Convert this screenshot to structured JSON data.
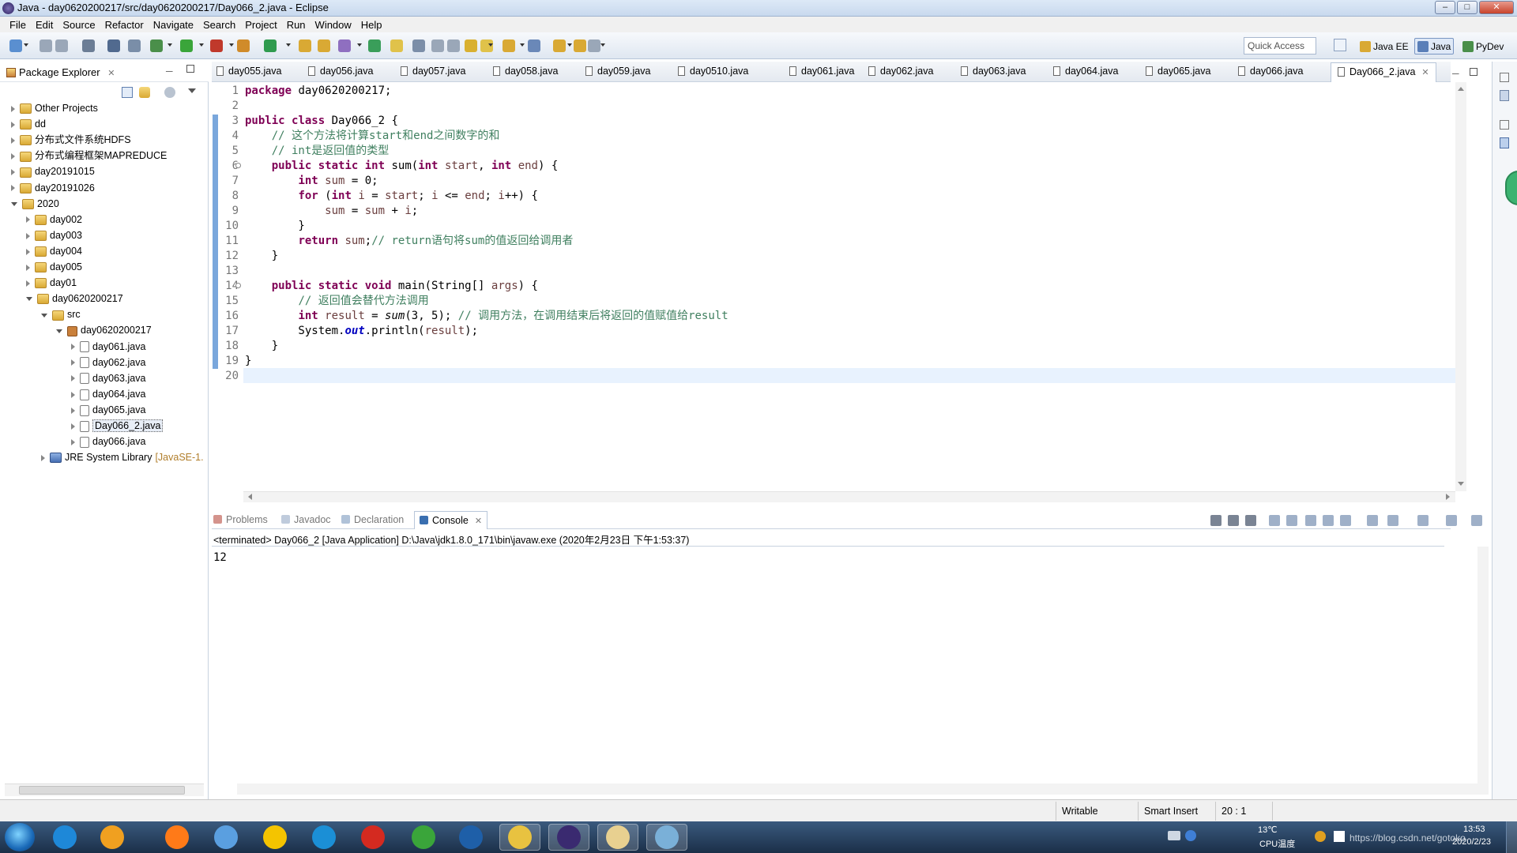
{
  "window": {
    "title": "Java - day0620200217/src/day0620200217/Day066_2.java - Eclipse"
  },
  "menu": [
    "File",
    "Edit",
    "Source",
    "Refactor",
    "Navigate",
    "Search",
    "Project",
    "Run",
    "Window",
    "Help"
  ],
  "quick_access": "Quick Access",
  "perspectives": [
    {
      "label": "Java EE",
      "selected": false
    },
    {
      "label": "Java",
      "selected": true
    },
    {
      "label": "PyDev",
      "selected": false
    }
  ],
  "package_explorer": {
    "title": "Package Explorer",
    "tree": [
      {
        "label": "Other Projects",
        "depth": 0,
        "state": "collapsed",
        "icon": "folder-icon"
      },
      {
        "label": "dd",
        "depth": 0,
        "state": "collapsed",
        "icon": "folder-icon"
      },
      {
        "label": "分布式文件系统HDFS",
        "depth": 0,
        "state": "collapsed",
        "icon": "folder-icon"
      },
      {
        "label": "分布式编程框架MAPREDUCE",
        "depth": 0,
        "state": "collapsed",
        "icon": "folder-icon"
      },
      {
        "label": "day20191015",
        "depth": 0,
        "state": "collapsed",
        "icon": "folder-icon"
      },
      {
        "label": "day20191026",
        "depth": 0,
        "state": "collapsed",
        "icon": "folder-icon"
      },
      {
        "label": "2020",
        "depth": 0,
        "state": "expanded",
        "icon": "folder-icon"
      },
      {
        "label": "day002",
        "depth": 1,
        "state": "collapsed",
        "icon": "project-icon"
      },
      {
        "label": "day003",
        "depth": 1,
        "state": "collapsed",
        "icon": "project-icon"
      },
      {
        "label": "day004",
        "depth": 1,
        "state": "collapsed",
        "icon": "project-icon"
      },
      {
        "label": "day005",
        "depth": 1,
        "state": "collapsed",
        "icon": "project-icon"
      },
      {
        "label": "day01",
        "depth": 1,
        "state": "collapsed",
        "icon": "project-icon"
      },
      {
        "label": "day0620200217",
        "depth": 1,
        "state": "expanded",
        "icon": "project-icon"
      },
      {
        "label": "src",
        "depth": 2,
        "state": "expanded",
        "icon": "src-folder-icon"
      },
      {
        "label": "day0620200217",
        "depth": 3,
        "state": "expanded",
        "icon": "package-icon"
      },
      {
        "label": "day061.java",
        "depth": 4,
        "state": "collapsed",
        "icon": "java-file-icon"
      },
      {
        "label": "day062.java",
        "depth": 4,
        "state": "collapsed",
        "icon": "java-file-icon"
      },
      {
        "label": "day063.java",
        "depth": 4,
        "state": "collapsed",
        "icon": "java-file-icon"
      },
      {
        "label": "day064.java",
        "depth": 4,
        "state": "collapsed",
        "icon": "java-file-icon"
      },
      {
        "label": "day065.java",
        "depth": 4,
        "state": "collapsed",
        "icon": "java-file-icon"
      },
      {
        "label": "Day066_2.java",
        "depth": 4,
        "state": "collapsed",
        "icon": "java-file-icon",
        "selected": true
      },
      {
        "label": "day066.java",
        "depth": 4,
        "state": "collapsed",
        "icon": "java-file-icon"
      },
      {
        "label": "JRE System Library",
        "suffix": "[JavaSE-1.",
        "depth": 2,
        "state": "collapsed",
        "icon": "library-icon"
      }
    ]
  },
  "editor_tabs": [
    "day055.java",
    "day056.java",
    "day057.java",
    "day058.java",
    "day059.java",
    "day0510.java",
    "day061.java",
    "day062.java",
    "day063.java",
    "day064.java",
    "day065.java",
    "day066.java",
    "Day066_2.java"
  ],
  "active_editor_tab": "Day066_2.java",
  "code_lines": [
    [
      {
        "t": "package",
        "c": "kw"
      },
      {
        "t": " day0620200217;"
      }
    ],
    [],
    [
      {
        "t": "public",
        "c": "kw"
      },
      {
        "t": " "
      },
      {
        "t": "class",
        "c": "kw"
      },
      {
        "t": " Day066_2 {"
      }
    ],
    [
      {
        "t": "    "
      },
      {
        "t": "// 这个方法将计算start和end之间数字的和",
        "c": "cm"
      }
    ],
    [
      {
        "t": "    "
      },
      {
        "t": "// int是返回值的类型",
        "c": "cm"
      }
    ],
    [
      {
        "t": "    "
      },
      {
        "t": "public",
        "c": "kw"
      },
      {
        "t": " "
      },
      {
        "t": "static",
        "c": "kw"
      },
      {
        "t": " "
      },
      {
        "t": "int",
        "c": "kw"
      },
      {
        "t": " sum("
      },
      {
        "t": "int",
        "c": "kw"
      },
      {
        "t": " "
      },
      {
        "t": "start",
        "c": "vr"
      },
      {
        "t": ", "
      },
      {
        "t": "int",
        "c": "kw"
      },
      {
        "t": " "
      },
      {
        "t": "end",
        "c": "vr"
      },
      {
        "t": ") {"
      }
    ],
    [
      {
        "t": "        "
      },
      {
        "t": "int",
        "c": "kw"
      },
      {
        "t": " "
      },
      {
        "t": "sum",
        "c": "vr"
      },
      {
        "t": " = 0;"
      }
    ],
    [
      {
        "t": "        "
      },
      {
        "t": "for",
        "c": "kw"
      },
      {
        "t": " ("
      },
      {
        "t": "int",
        "c": "kw"
      },
      {
        "t": " "
      },
      {
        "t": "i",
        "c": "vr"
      },
      {
        "t": " = "
      },
      {
        "t": "start",
        "c": "vr"
      },
      {
        "t": "; "
      },
      {
        "t": "i",
        "c": "vr"
      },
      {
        "t": " <= "
      },
      {
        "t": "end",
        "c": "vr"
      },
      {
        "t": "; "
      },
      {
        "t": "i",
        "c": "vr"
      },
      {
        "t": "++) {"
      }
    ],
    [
      {
        "t": "            "
      },
      {
        "t": "sum",
        "c": "vr"
      },
      {
        "t": " = "
      },
      {
        "t": "sum",
        "c": "vr"
      },
      {
        "t": " + "
      },
      {
        "t": "i",
        "c": "vr"
      },
      {
        "t": ";"
      }
    ],
    [
      {
        "t": "        }"
      }
    ],
    [
      {
        "t": "        "
      },
      {
        "t": "return",
        "c": "kw"
      },
      {
        "t": " "
      },
      {
        "t": "sum",
        "c": "vr"
      },
      {
        "t": ";"
      },
      {
        "t": "// return语句将sum的值返回给调用者",
        "c": "cm"
      }
    ],
    [
      {
        "t": "    }"
      }
    ],
    [],
    [
      {
        "t": "    "
      },
      {
        "t": "public",
        "c": "kw"
      },
      {
        "t": " "
      },
      {
        "t": "static",
        "c": "kw"
      },
      {
        "t": " "
      },
      {
        "t": "void",
        "c": "kw"
      },
      {
        "t": " main(String[] "
      },
      {
        "t": "args",
        "c": "vr"
      },
      {
        "t": ") {"
      }
    ],
    [
      {
        "t": "        "
      },
      {
        "t": "// 返回值会替代方法调用",
        "c": "cm"
      }
    ],
    [
      {
        "t": "        "
      },
      {
        "t": "int",
        "c": "kw"
      },
      {
        "t": " "
      },
      {
        "t": "result",
        "c": "vr"
      },
      {
        "t": " = "
      },
      {
        "t": "sum",
        "c": "st"
      },
      {
        "t": "(3, 5); "
      },
      {
        "t": "// 调用方法，在调用结束后将返回的值赋值给result",
        "c": "cm"
      }
    ],
    [
      {
        "t": "        System."
      },
      {
        "t": "out",
        "c": "fld"
      },
      {
        "t": ".println("
      },
      {
        "t": "result",
        "c": "vr"
      },
      {
        "t": ");"
      }
    ],
    [
      {
        "t": "    }"
      }
    ],
    [
      {
        "t": "}"
      }
    ],
    []
  ],
  "bottom_tabs": [
    {
      "label": "Problems",
      "active": false
    },
    {
      "label": "Javadoc",
      "active": false
    },
    {
      "label": "Declaration",
      "active": false
    },
    {
      "label": "Console",
      "active": true
    }
  ],
  "console": {
    "header": "<terminated> Day066_2 [Java Application] D:\\Java\\jdk1.8.0_171\\bin\\javaw.exe (2020年2月23日 下午1:53:37)",
    "output": "12"
  },
  "status": {
    "writable": "Writable",
    "insert_mode": "Smart Insert",
    "position": "20 : 1"
  },
  "taskbar": {
    "weather_temp": "13℃",
    "weather_label": "CPU温度",
    "time": "13:53",
    "date": "2020/2/23",
    "watermark": "https://blog.csdn.net/gotoko"
  },
  "colors": {
    "keyword": "#7f0055",
    "comment": "#3f7f5f",
    "variable": "#6a3e3e",
    "field": "#0000c0"
  }
}
